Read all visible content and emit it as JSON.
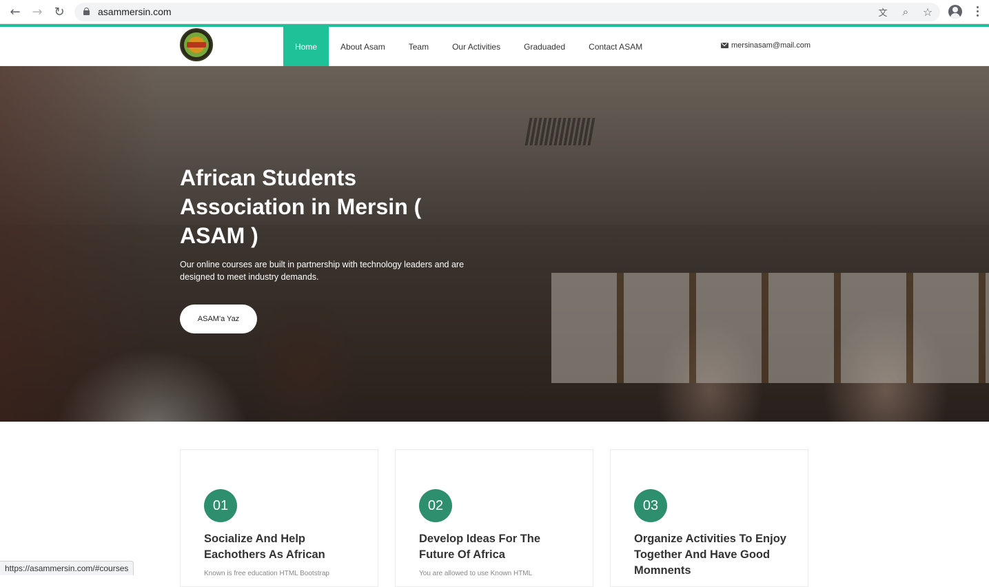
{
  "browser": {
    "url": "asammersin.com",
    "status_url": "https://asammersin.com/#courses",
    "icons": [
      "back-icon",
      "forward-icon",
      "reload-icon",
      "lock-icon",
      "translate-icon",
      "zoom-icon",
      "star-icon",
      "profile-icon",
      "menu-icon"
    ]
  },
  "nav": {
    "items": [
      "Home",
      "About Asam",
      "Team",
      "Our Activities",
      "Graduaded",
      "Contact ASAM"
    ],
    "active": "Home",
    "email": "mersinasam@mail.com"
  },
  "hero": {
    "title": "African Students Association in Mersin ( ASAM )",
    "subtitle": "Our online courses are built in partnership with technology leaders and are designed to meet industry demands.",
    "button": "ASAM'a Yaz"
  },
  "cards": [
    {
      "number": "01",
      "title": "Socialize And Help Eachothers As African",
      "text": "Known is free education HTML Bootstrap"
    },
    {
      "number": "02",
      "title": "Develop Ideas For The Future Of Africa",
      "text": "You are allowed to use Known HTML"
    },
    {
      "number": "03",
      "title": "Organize Activities To Enjoy Together And Have Good Momnents",
      "text": ""
    }
  ],
  "colors": {
    "accent": "#1fc198",
    "number_badge": "#2e8f6f"
  }
}
